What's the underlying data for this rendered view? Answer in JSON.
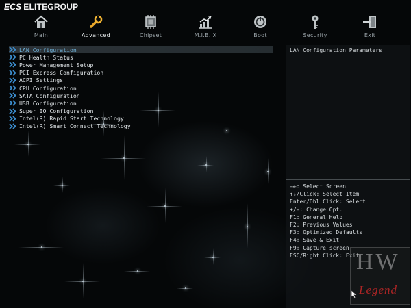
{
  "brand": {
    "logo": "ECS",
    "name": "ELITEGROUP"
  },
  "tabs": [
    {
      "label": "Main",
      "icon": "house-icon"
    },
    {
      "label": "Advanced",
      "icon": "wrench-icon"
    },
    {
      "label": "Chipset",
      "icon": "chip-icon"
    },
    {
      "label": "M.I.B. X",
      "icon": "chart-icon"
    },
    {
      "label": "Boot",
      "icon": "power-icon"
    },
    {
      "label": "Security",
      "icon": "key-icon"
    },
    {
      "label": "Exit",
      "icon": "exit-door-icon"
    }
  ],
  "active_tab": "Advanced",
  "menu": {
    "selected_index": 0,
    "items": [
      {
        "label": "LAN Configuration"
      },
      {
        "label": "PC Health Status"
      },
      {
        "label": "Power Management Setup"
      },
      {
        "label": "PCI Express Configuration"
      },
      {
        "label": "ACPI Settings"
      },
      {
        "label": "CPU Configuration"
      },
      {
        "label": "SATA Configuration"
      },
      {
        "label": "USB Configuration"
      },
      {
        "label": "Super IO Configuration"
      },
      {
        "label": "Intel(R) Rapid Start Technology"
      },
      {
        "label": "Intel(R) Smart Connect Technology"
      }
    ]
  },
  "help": {
    "title": "LAN Configuration Parameters",
    "keys": [
      "→←: Select Screen",
      "↑↓/Click: Select Item",
      "Enter/Dbl Click: Select",
      "+/-: Change Opt.",
      "F1: General Help",
      "F2: Previous Values",
      "F3: Optimized Defaults",
      "F4: Save & Exit",
      "F9: Capture screen",
      "ESC/Right Click: Exit"
    ]
  },
  "watermark": {
    "top": "HW",
    "bottom": "Legend"
  },
  "colors": {
    "selected_text": "#6fb1d8",
    "chevron": "#3d8fd0",
    "watermark_accent": "#c82828"
  }
}
